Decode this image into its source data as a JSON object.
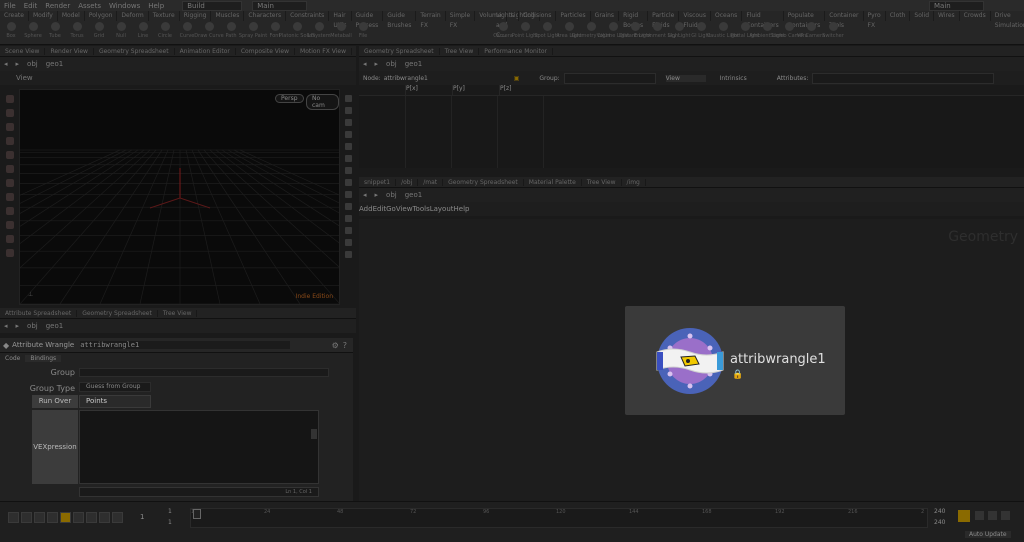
{
  "menubar": {
    "items": [
      "File",
      "Edit",
      "Render",
      "Assets",
      "Windows",
      "Help"
    ],
    "desktop": "Build",
    "context": "Main",
    "right_field": "Main"
  },
  "shelf": {
    "left_tabs": [
      "Create",
      "Modify",
      "Model",
      "Polygon",
      "Deform",
      "Texture",
      "Rigging",
      "Muscles",
      "Characters",
      "Constraints",
      "Hair Utils",
      "Guide Process",
      "Guide Brushes",
      "Terrain FX",
      "Simple FX",
      "Volume",
      "Lighting"
    ],
    "left_tools": [
      "Box",
      "Sphere",
      "Tube",
      "Torus",
      "Grid",
      "Null",
      "Line",
      "Circle",
      "Curve",
      "Draw Curve",
      "Path",
      "Spray Paint",
      "Font",
      "Platonic Solids",
      "L-System",
      "Metaball",
      "File"
    ],
    "right_tabs": [
      "Lights and C...",
      "Collisions",
      "Particles",
      "Grains",
      "Rigid Bodies",
      "Particle Fluids",
      "Viscous Fluids",
      "Oceans",
      "Fluid Containers",
      "Populate Containers",
      "Container Tools",
      "Pyro FX",
      "Cloth",
      "Solid",
      "Wires",
      "Crowds",
      "Drive Simulation"
    ],
    "right_tools": [
      "Camera",
      "Point Light",
      "Spot Light",
      "Area Light",
      "Geometry Light",
      "Volume Light",
      "Distant Light",
      "Environment Light",
      "Sky Light",
      "GI Light",
      "Caustic Light",
      "Portal Light",
      "Ambient Light",
      "Stereo Camera",
      "VR Camera",
      "Switcher"
    ]
  },
  "left_pane": {
    "tabs": [
      "Scene View",
      "Render View",
      "Geometry Spreadsheet",
      "Animation Editor",
      "Composite View",
      "Motion FX View"
    ],
    "path_obj": "obj",
    "path_geo": "geo1",
    "view_label": "View",
    "persp_button": "Persp",
    "camera_button": "No cam",
    "viewport_footer": "Indie Edition"
  },
  "top_right_pane": {
    "tabs": [
      "Geometry Spreadsheet",
      "Tree View",
      "Performance Monitor"
    ],
    "path_obj": "obj",
    "path_geo": "geo1",
    "node_label": "Node:",
    "node_value": "attribwrangle1",
    "group_label": "Group:",
    "view_label": "View",
    "intrinsics_label": "Intrinsics",
    "attrib_label": "Attributes:",
    "columns": [
      "",
      "P[x]",
      "P[y]",
      "P[z]"
    ]
  },
  "params": {
    "tabs": [
      "Attribute Spreadsheet",
      "Geometry Spreadsheet",
      "Tree View"
    ],
    "path_obj": "obj",
    "path_geo": "geo1",
    "node_type": "Attribute Wrangle",
    "node_name": "attribwrangle1",
    "subtabs": [
      "Code",
      "Bindings"
    ],
    "group_label": "Group",
    "group_type_label": "Group Type",
    "group_type_value": "Guess from Group",
    "run_over_label": "Run Over",
    "run_over_value": "Points",
    "vex_label": "VEXpression",
    "line_info": "Ln 1, Col 1"
  },
  "network": {
    "tabs": [
      "snippet1",
      "/obj",
      "/mat",
      "Geometry Spreadsheet",
      "Material Palette",
      "Tree View",
      "/img"
    ],
    "path_obj": "obj",
    "path_geo": "geo1",
    "menu": [
      "Add",
      "Edit",
      "Go",
      "View",
      "Tools",
      "Layout",
      "Help"
    ],
    "watermark": "Geometry",
    "popup_node_name": "attribwrangle1"
  },
  "timeline": {
    "frame": "1",
    "start": "1",
    "start2": "1",
    "ticks": [
      "1",
      "24",
      "48",
      "72",
      "96",
      "120",
      "144",
      "168",
      "192",
      "216",
      "2"
    ],
    "end": "240",
    "end2": "240",
    "auto_update": "Auto Update"
  },
  "colors": {
    "background": "#1a1a1a",
    "popup": "#3a3a3a",
    "node_ring": "#4a63b8",
    "node_inner": "#9a6fc9",
    "accent": "#c8a000"
  }
}
